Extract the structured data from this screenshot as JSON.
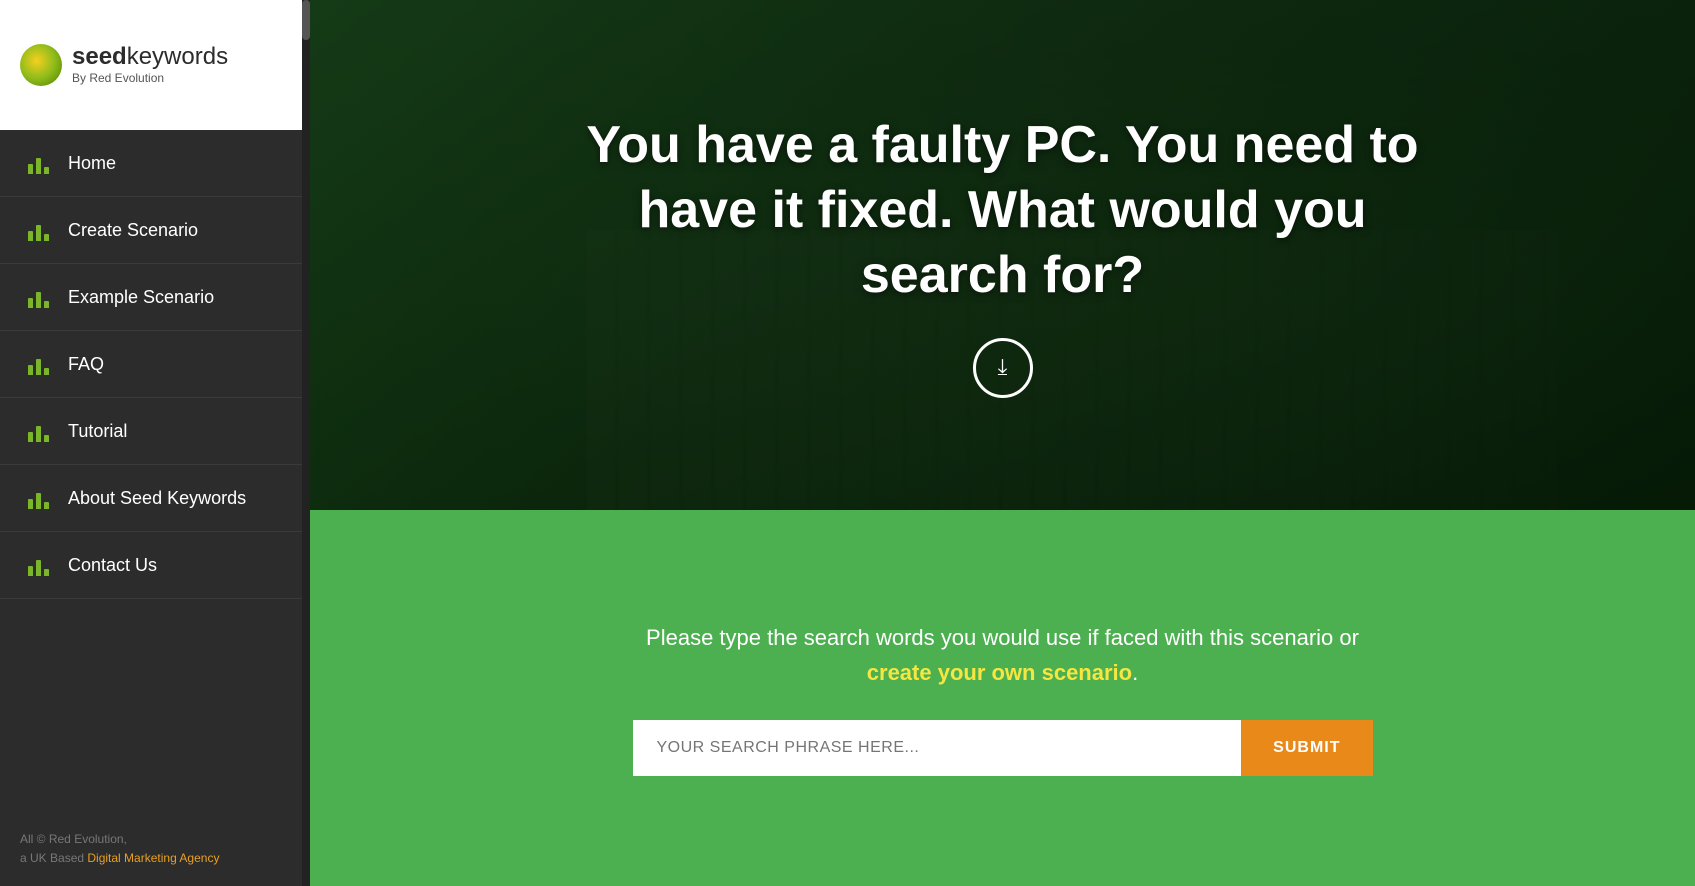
{
  "logo": {
    "bold": "seed",
    "light": "keywords",
    "subline": "By Red Evolution"
  },
  "nav": {
    "items": [
      {
        "id": "home",
        "label": "Home"
      },
      {
        "id": "create-scenario",
        "label": "Create Scenario"
      },
      {
        "id": "example-scenario",
        "label": "Example Scenario"
      },
      {
        "id": "faq",
        "label": "FAQ"
      },
      {
        "id": "tutorial",
        "label": "Tutorial"
      },
      {
        "id": "about-seed-keywords",
        "label": "About Seed Keywords"
      },
      {
        "id": "contact-us",
        "label": "Contact Us"
      }
    ]
  },
  "footer": {
    "line1": "All © Red Evolution,",
    "line2": "a UK Based ",
    "link_text": "Digital Marketing Agency"
  },
  "hero": {
    "title": "You have a faulty PC. You need to have it fixed. What would you search for?"
  },
  "search_section": {
    "description_part1": "Please type the search words you would use if faced with this scenario or ",
    "link_text": "create your own scenario",
    "description_part2": ".",
    "input_placeholder": "YOUR SEARCH PHRASE HERE...",
    "submit_label": "SUBMIT"
  }
}
